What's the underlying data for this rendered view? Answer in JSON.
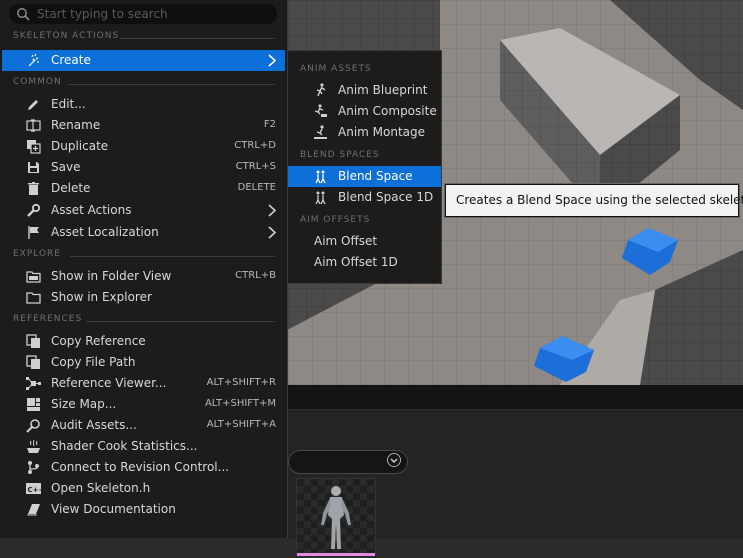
{
  "search": {
    "placeholder": "Start typing to search"
  },
  "menu": {
    "sections": {
      "skeleton_actions": "SKELETON ACTIONS",
      "common": "COMMON",
      "explore": "EXPLORE",
      "references": "REFERENCES"
    },
    "create": {
      "label": "Create",
      "icon": "create-icon"
    },
    "common_items": [
      {
        "label": "Edit...",
        "shortcut": "",
        "icon": "pencil-icon"
      },
      {
        "label": "Rename",
        "shortcut": "F2",
        "icon": "rename-icon"
      },
      {
        "label": "Duplicate",
        "shortcut": "CTRL+D",
        "icon": "duplicate-icon"
      },
      {
        "label": "Save",
        "shortcut": "CTRL+S",
        "icon": "save-icon"
      },
      {
        "label": "Delete",
        "shortcut": "DELETE",
        "icon": "trash-icon"
      },
      {
        "label": "Asset Actions",
        "shortcut": "",
        "icon": "wrench-icon"
      },
      {
        "label": "Asset Localization",
        "shortcut": "",
        "icon": "flag-icon"
      }
    ],
    "explore_items": [
      {
        "label": "Show in Folder View",
        "shortcut": "CTRL+B",
        "icon": "folder-icon"
      },
      {
        "label": "Show in Explorer",
        "shortcut": "",
        "icon": "folder-icon"
      }
    ],
    "reference_items": [
      {
        "label": "Copy Reference",
        "shortcut": "",
        "icon": "copy-icon"
      },
      {
        "label": "Copy File Path",
        "shortcut": "",
        "icon": "copy-icon"
      },
      {
        "label": "Reference Viewer...",
        "shortcut": "ALT+SHIFT+R",
        "icon": "reference-viewer-icon"
      },
      {
        "label": "Size Map...",
        "shortcut": "ALT+SHIFT+M",
        "icon": "size-map-icon"
      },
      {
        "label": "Audit Assets...",
        "shortcut": "ALT+SHIFT+A",
        "icon": "audit-icon"
      },
      {
        "label": "Shader Cook Statistics...",
        "shortcut": "",
        "icon": "shader-icon"
      },
      {
        "label": "Connect to Revision Control...",
        "shortcut": "",
        "icon": "revision-control-icon"
      },
      {
        "label": "Open Skeleton.h",
        "shortcut": "",
        "icon": "cpp-file-icon"
      },
      {
        "label": "View Documentation",
        "shortcut": "",
        "icon": "book-icon"
      }
    ]
  },
  "submenu": {
    "anim_assets_header": "ANIM ASSETS",
    "anim_assets": [
      {
        "label": "Anim Blueprint",
        "icon": "anim-blueprint-icon"
      },
      {
        "label": "Anim Composite",
        "icon": "anim-composite-icon"
      },
      {
        "label": "Anim Montage",
        "icon": "anim-montage-icon"
      }
    ],
    "blend_spaces_header": "BLEND SPACES",
    "blend_spaces": [
      {
        "label": "Blend Space",
        "icon": "blend-space-icon"
      },
      {
        "label": "Blend Space 1D",
        "icon": "blend-space-1d-icon"
      }
    ],
    "aim_offsets_header": "AIM OFFSETS",
    "aim_offsets": [
      {
        "label": "Aim Offset"
      },
      {
        "label": "Aim Offset 1D"
      }
    ]
  },
  "tooltip": {
    "text": "Creates a Blend Space using the selected skeleton."
  },
  "colors": {
    "highlight": "#0d6fd8",
    "menu_bg": "#1c1c1c",
    "asset_bar": "#e78be0"
  }
}
